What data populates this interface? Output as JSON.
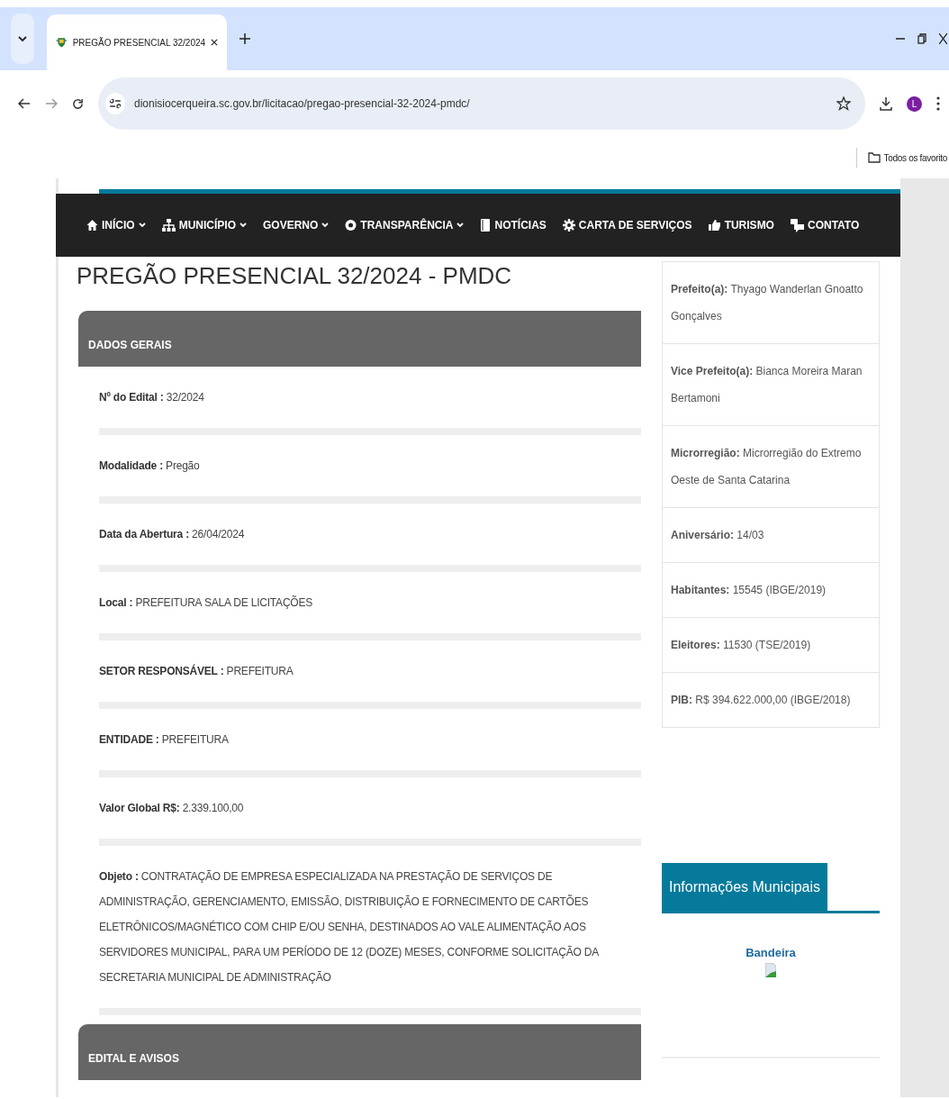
{
  "browser": {
    "tab_title": "PREGÃO PRESENCIAL 32/2024",
    "url": "dionisiocerqueira.sc.gov.br/licitacao/pregao-presencial-32-2024-pmdc/",
    "profile_initial": "L",
    "bookmarks_folder": "Todos os favorito"
  },
  "nav": [
    {
      "kind": "home",
      "label": "INÍCIO",
      "dropdown": true
    },
    {
      "kind": "sitemap",
      "label": "MUNICÍPIO",
      "dropdown": true
    },
    {
      "label": "GOVERNO",
      "dropdown": true
    },
    {
      "kind": "badge",
      "label": "TRANSPARÊNCIA",
      "dropdown": true
    },
    {
      "kind": "book",
      "label": "NOTÍCIAS",
      "dropdown": false
    },
    {
      "kind": "gear",
      "label": "CARTA DE SERVIÇOS",
      "dropdown": false
    },
    {
      "kind": "thumb",
      "label": "TURISMO",
      "dropdown": false
    },
    {
      "kind": "chat",
      "label": "CONTATO",
      "dropdown": false
    }
  ],
  "page_title": "PREGÃO PRESENCIAL 32/2024 - PMDC",
  "sections": [
    {
      "title": "DADOS GERAIS",
      "fields": [
        "**Nº do Edital :** 32/2024",
        "**Modalidade :** Pregão",
        "**Data da Abertura :** 26/04/2024",
        "**Local :** PREFEITURA SALA DE LICITAÇÕES",
        "**SETOR RESPONSÁVEL :** PREFEITURA",
        "**ENTIDADE :** PREFEITURA",
        "**Valor Global R$:** 2.339.100,00",
        "**Objeto :** CONTRATAÇÃO DE EMPRESA ESPECIALIZADA NA PRESTAÇÃO DE SERVIÇOS DE ADMINISTRAÇÃO, GERENCIAMENTO, EMISSÃO, DISTRIBUIÇÃO E FORNECIMENTO DE CARTÕES ELETRÔNICOS/MAGNÉTICO COM CHIP E/OU SENHA, DESTINADOS AO VALE ALIMENTAÇÃO AOS SERVIDORES MUNICIPAL, PARA UM PERÍODO DE 12 (DOZE) MESES, CONFORME SOLICITAÇÃO DA SECRETARIA MUNICIPAL DE ADMINISTRAÇÃO"
      ]
    },
    {
      "title": "EDITAL E AVISOS"
    }
  ],
  "sidebar": {
    "facts": [
      "**Prefeito(a):**  Thyago Wanderlan Gnoatto Gonçalves",
      "**Vice Prefeito(a):**  Bianca Moreira Maran Bertamoni",
      "**Microrregião:**  Microrregião do Extremo Oeste de Santa Catarina",
      "**Aniversário:** 14/03",
      "**Habitantes:** 15545 (IBGE/2019)",
      "**Eleitores:**  11530 (TSE/2019)",
      "**PIB:** R$ 394.622.000,00 (IBGE/2018)"
    ],
    "info_title": "Informações Municipais",
    "flag_link": "Bandeira"
  }
}
